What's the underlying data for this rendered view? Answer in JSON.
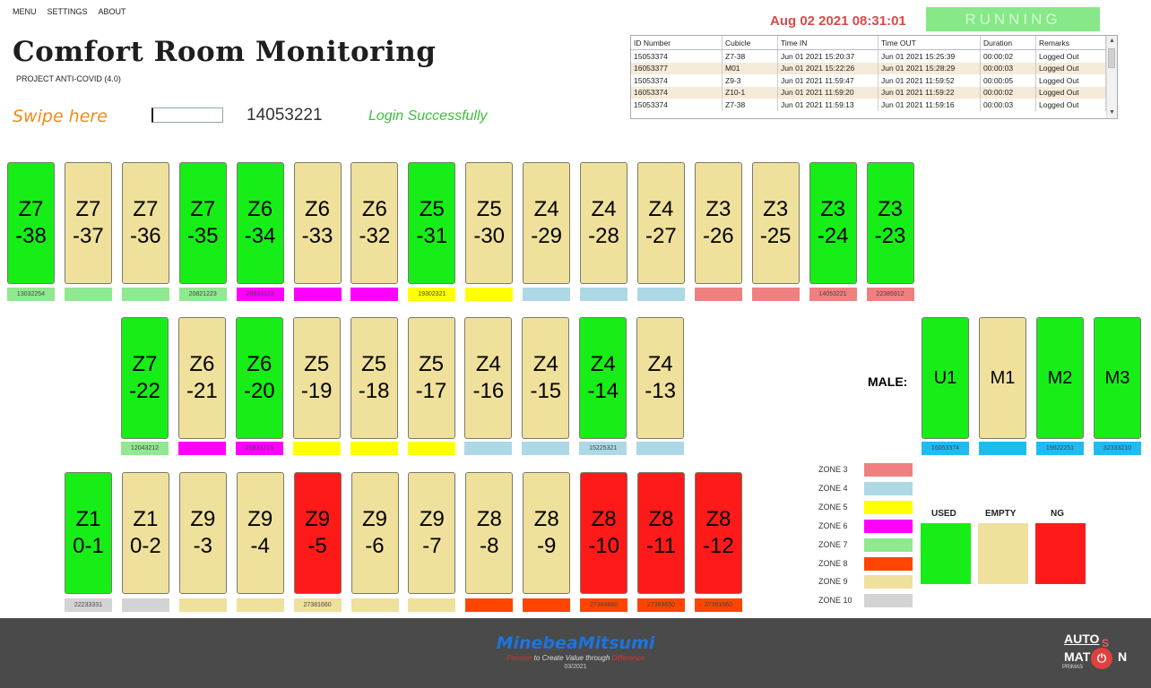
{
  "menu": {
    "items": [
      "MENU",
      "SETTINGS",
      "ABOUT"
    ]
  },
  "app": {
    "title": "Comfort Room Monitoring",
    "subtitle": "PROJECT ANTI-COVID (4.0)"
  },
  "swipe": {
    "label": "Swipe here",
    "input_value": "",
    "card_number": "14053221",
    "message": "Login Successfully"
  },
  "status": {
    "datetime": "Aug 02 2021 08:31:01",
    "running": "RUNNING"
  },
  "log": {
    "headers": [
      "ID Number",
      "Cubicle",
      "Time IN",
      "Time OUT",
      "Duration",
      "Remarks"
    ],
    "rows": [
      [
        "15053374",
        "Z7-38",
        "Jun 01 2021 15:20:37",
        "Jun 01 2021 15:25:39",
        "00:00:02",
        "Logged Out"
      ],
      [
        "16053377",
        "M01",
        "Jun 01 2021 15:22:26",
        "Jun 01 2021 15:28:29",
        "00:00:03",
        "Logged Out"
      ],
      [
        "15053374",
        "Z9-3",
        "Jun 01 2021 11:59:47",
        "Jun 01 2021 11:59:52",
        "00:00:05",
        "Logged Out"
      ],
      [
        "16053374",
        "Z10-1",
        "Jun 01 2021 11:59:20",
        "Jun 01 2021 11:59:22",
        "00:00:02",
        "Logged Out"
      ],
      [
        "15053374",
        "Z7-38",
        "Jun 01 2021 11:59:13",
        "Jun 01 2021 11:59:16",
        "00:00:03",
        "Logged Out"
      ]
    ]
  },
  "colors": {
    "used": "#17ee17",
    "empty": "#efe09c",
    "ng": "#ff1a1a"
  },
  "stalls_row1": [
    {
      "label": "Z7\n-38",
      "state": "used",
      "tag": "13032254",
      "tag_color": "#90e890"
    },
    {
      "label": "Z7\n-37",
      "state": "empty",
      "tag": "",
      "tag_color": "#90e890"
    },
    {
      "label": "Z7\n-36",
      "state": "empty",
      "tag": "",
      "tag_color": "#90e890"
    },
    {
      "label": "Z7\n-35",
      "state": "used",
      "tag": "20821223",
      "tag_color": "#90e890"
    },
    {
      "label": "Z6\n-34",
      "state": "used",
      "tag": "28833123",
      "tag_color": "#ff00ff"
    },
    {
      "label": "Z6\n-33",
      "state": "empty",
      "tag": "",
      "tag_color": "#ff00ff"
    },
    {
      "label": "Z6\n-32",
      "state": "empty",
      "tag": "",
      "tag_color": "#ff00ff"
    },
    {
      "label": "Z5\n-31",
      "state": "used",
      "tag": "19302321",
      "tag_color": "#ffff00"
    },
    {
      "label": "Z5\n-30",
      "state": "empty",
      "tag": "",
      "tag_color": "#ffff00"
    },
    {
      "label": "Z4\n-29",
      "state": "empty",
      "tag": "",
      "tag_color": "#add8e6"
    },
    {
      "label": "Z4\n-28",
      "state": "empty",
      "tag": "",
      "tag_color": "#add8e6"
    },
    {
      "label": "Z4\n-27",
      "state": "empty",
      "tag": "",
      "tag_color": "#add8e6"
    },
    {
      "label": "Z3\n-26",
      "state": "empty",
      "tag": "",
      "tag_color": "#f08080"
    },
    {
      "label": "Z3\n-25",
      "state": "empty",
      "tag": "",
      "tag_color": "#f08080"
    },
    {
      "label": "Z3\n-24",
      "state": "used",
      "tag": "14053221",
      "tag_color": "#f08080"
    },
    {
      "label": "Z3\n-23",
      "state": "used",
      "tag": "22385912",
      "tag_color": "#f08080"
    }
  ],
  "stalls_row2": [
    {
      "label": "Z7\n-22",
      "state": "used",
      "tag": "12043212",
      "tag_color": "#90e890"
    },
    {
      "label": "Z6\n-21",
      "state": "empty",
      "tag": "",
      "tag_color": "#ff00ff"
    },
    {
      "label": "Z6\n-20",
      "state": "used",
      "tag": "20831213",
      "tag_color": "#ff00ff"
    },
    {
      "label": "Z5\n-19",
      "state": "empty",
      "tag": "",
      "tag_color": "#ffff00"
    },
    {
      "label": "Z5\n-18",
      "state": "empty",
      "tag": "",
      "tag_color": "#ffff00"
    },
    {
      "label": "Z5\n-17",
      "state": "empty",
      "tag": "",
      "tag_color": "#ffff00"
    },
    {
      "label": "Z4\n-16",
      "state": "empty",
      "tag": "",
      "tag_color": "#add8e6"
    },
    {
      "label": "Z4\n-15",
      "state": "empty",
      "tag": "",
      "tag_color": "#add8e6"
    },
    {
      "label": "Z4\n-14",
      "state": "used",
      "tag": "15225321",
      "tag_color": "#add8e6"
    },
    {
      "label": "Z4\n-13",
      "state": "empty",
      "tag": "",
      "tag_color": "#add8e6"
    }
  ],
  "stalls_row3": [
    {
      "label": "Z1\n0-1",
      "state": "used",
      "tag": "22233331",
      "tag_color": "#d3d3d3"
    },
    {
      "label": "Z1\n0-2",
      "state": "empty",
      "tag": "",
      "tag_color": "#d3d3d3"
    },
    {
      "label": "Z9\n-3",
      "state": "empty",
      "tag": "",
      "tag_color": "#efe09c"
    },
    {
      "label": "Z9\n-4",
      "state": "empty",
      "tag": "",
      "tag_color": "#efe09c"
    },
    {
      "label": "Z9\n-5",
      "state": "ng",
      "tag": "27381660",
      "tag_color": "#efe09c"
    },
    {
      "label": "Z9\n-6",
      "state": "empty",
      "tag": "",
      "tag_color": "#efe09c"
    },
    {
      "label": "Z9\n-7",
      "state": "empty",
      "tag": "",
      "tag_color": "#efe09c"
    },
    {
      "label": "Z8\n-8",
      "state": "empty",
      "tag": "",
      "tag_color": "#ff4500"
    },
    {
      "label": "Z8\n-9",
      "state": "empty",
      "tag": "",
      "tag_color": "#ff4500"
    },
    {
      "label": "Z8\n-10",
      "state": "ng",
      "tag": "27384680",
      "tag_color": "#ff4500"
    },
    {
      "label": "Z8\n-11",
      "state": "ng",
      "tag": "27389650",
      "tag_color": "#ff4500"
    },
    {
      "label": "Z8\n-12",
      "state": "ng",
      "tag": "27381660",
      "tag_color": "#ff4500"
    }
  ],
  "male": {
    "label": "MALE:",
    "stalls": [
      {
        "label": "U1",
        "state": "used",
        "tag": "16053374",
        "tag_color": "#1fbcf0"
      },
      {
        "label": "M1",
        "state": "empty",
        "tag": "",
        "tag_color": "#1fbcf0"
      },
      {
        "label": "M2",
        "state": "used",
        "tag": "19622251",
        "tag_color": "#1fbcf0"
      },
      {
        "label": "M3",
        "state": "used",
        "tag": "32333210",
        "tag_color": "#1fbcf0"
      }
    ]
  },
  "zones": [
    {
      "label": "ZONE 3",
      "color": "#f08080"
    },
    {
      "label": "ZONE 4",
      "color": "#add8e6"
    },
    {
      "label": "ZONE 5",
      "color": "#ffff00"
    },
    {
      "label": "ZONE 6",
      "color": "#ff00ff"
    },
    {
      "label": "ZONE 7",
      "color": "#90e890"
    },
    {
      "label": "ZONE 8",
      "color": "#ff4500"
    },
    {
      "label": "ZONE 9",
      "color": "#efe09c"
    },
    {
      "label": "ZONE 10",
      "color": "#d3d3d3"
    }
  ],
  "legend": {
    "used": "USED",
    "empty": "EMPTY",
    "ng": "NG"
  },
  "footer": {
    "brand": "MinebeaMitsumi",
    "tagline_start": "Passion",
    "tagline_mid": " to Create Value through ",
    "tagline_end": "Difference",
    "date": "03/2021",
    "logo_top": "AUTO",
    "logo_s": "S",
    "logo_mat": "MAT",
    "logo_n": "N",
    "logo_sub": "PRIMAS"
  }
}
